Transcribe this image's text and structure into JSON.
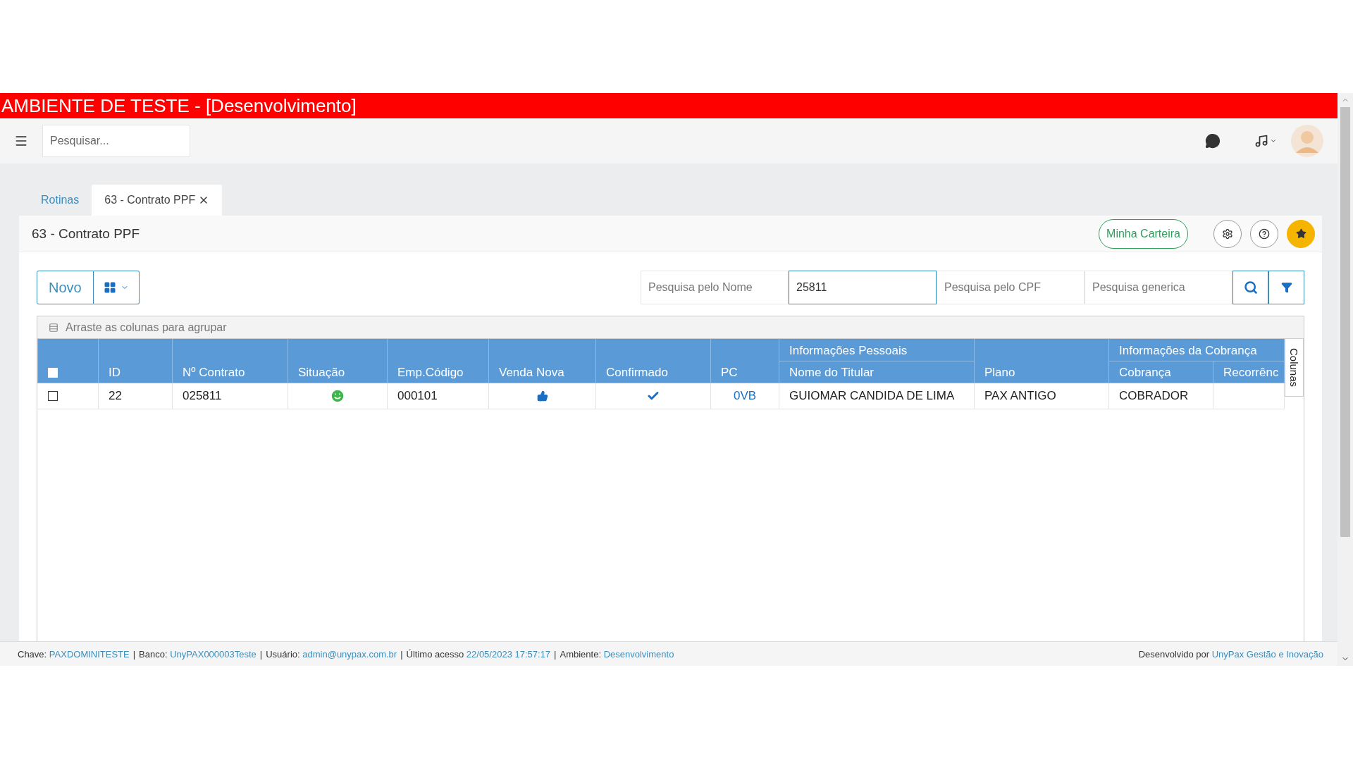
{
  "environment_banner": "AMBIENTE DE TESTE - [Desenvolvimento]",
  "topbar": {
    "search_placeholder": "Pesquisar..."
  },
  "tabs": [
    {
      "label": "Rotinas",
      "selected": false,
      "closable": false
    },
    {
      "label": "63 - Contrato PPF",
      "selected": true,
      "closable": true
    }
  ],
  "page": {
    "title": "63 - Contrato PPF",
    "wallet_button": "Minha Carteira"
  },
  "toolbar": {
    "new_button": "Novo",
    "filters": [
      {
        "placeholder": "Pesquisa pelo Nome",
        "focused": false
      },
      {
        "value": "25811",
        "focused": true
      },
      {
        "placeholder": "Pesquisa pelo CPF",
        "focused": false
      },
      {
        "placeholder": "Pesquisa generica",
        "focused": false
      }
    ]
  },
  "grid": {
    "select_all_checked": false,
    "group_hint": "Arraste as colunas para agrupar",
    "side_tab": "Colunas",
    "columns": [
      {
        "kind": "single",
        "label": "ID"
      },
      {
        "kind": "single",
        "label": "Nº Contrato"
      },
      {
        "kind": "single",
        "label": "Situação"
      },
      {
        "kind": "single",
        "label": "Emp.Código"
      },
      {
        "kind": "single",
        "label": "Venda Nova"
      },
      {
        "kind": "single",
        "label": "Confirmado"
      },
      {
        "kind": "single",
        "label": "PC"
      },
      {
        "kind": "group",
        "label": "Informações Pessoais",
        "children": [
          "Nome do Titular"
        ]
      },
      {
        "kind": "single",
        "label": "Plano"
      },
      {
        "kind": "group",
        "label": "Informações da Cobrança",
        "children": [
          "Cobrança",
          "Recorrênc"
        ]
      }
    ],
    "rows": [
      {
        "checked": false,
        "id": "22",
        "contrato": "025811",
        "situacao_ok": true,
        "emp_codigo": "000101",
        "venda_nova": true,
        "confirmado": true,
        "pc": "0VB",
        "nome": "GUIOMAR CANDIDA DE LIMA",
        "plano": "PAX ANTIGO",
        "cobranca": "COBRADOR"
      }
    ]
  },
  "footer": {
    "items": [
      {
        "label": "Chave:",
        "value": "PAXDOMINITESTE"
      },
      {
        "label": "Banco:",
        "value": "UnyPAX000003Teste"
      },
      {
        "label": "Usuário:",
        "value": "admin@unypax.com.br"
      },
      {
        "label": "Último acesso",
        "value": "22/05/2023 17:57:17"
      },
      {
        "label": "Ambiente:",
        "value": "Desenvolvimento"
      }
    ],
    "separator": "|",
    "credit_label": "Desenvolvido por",
    "credit_value": "UnyPax Gestão e Inovação"
  }
}
